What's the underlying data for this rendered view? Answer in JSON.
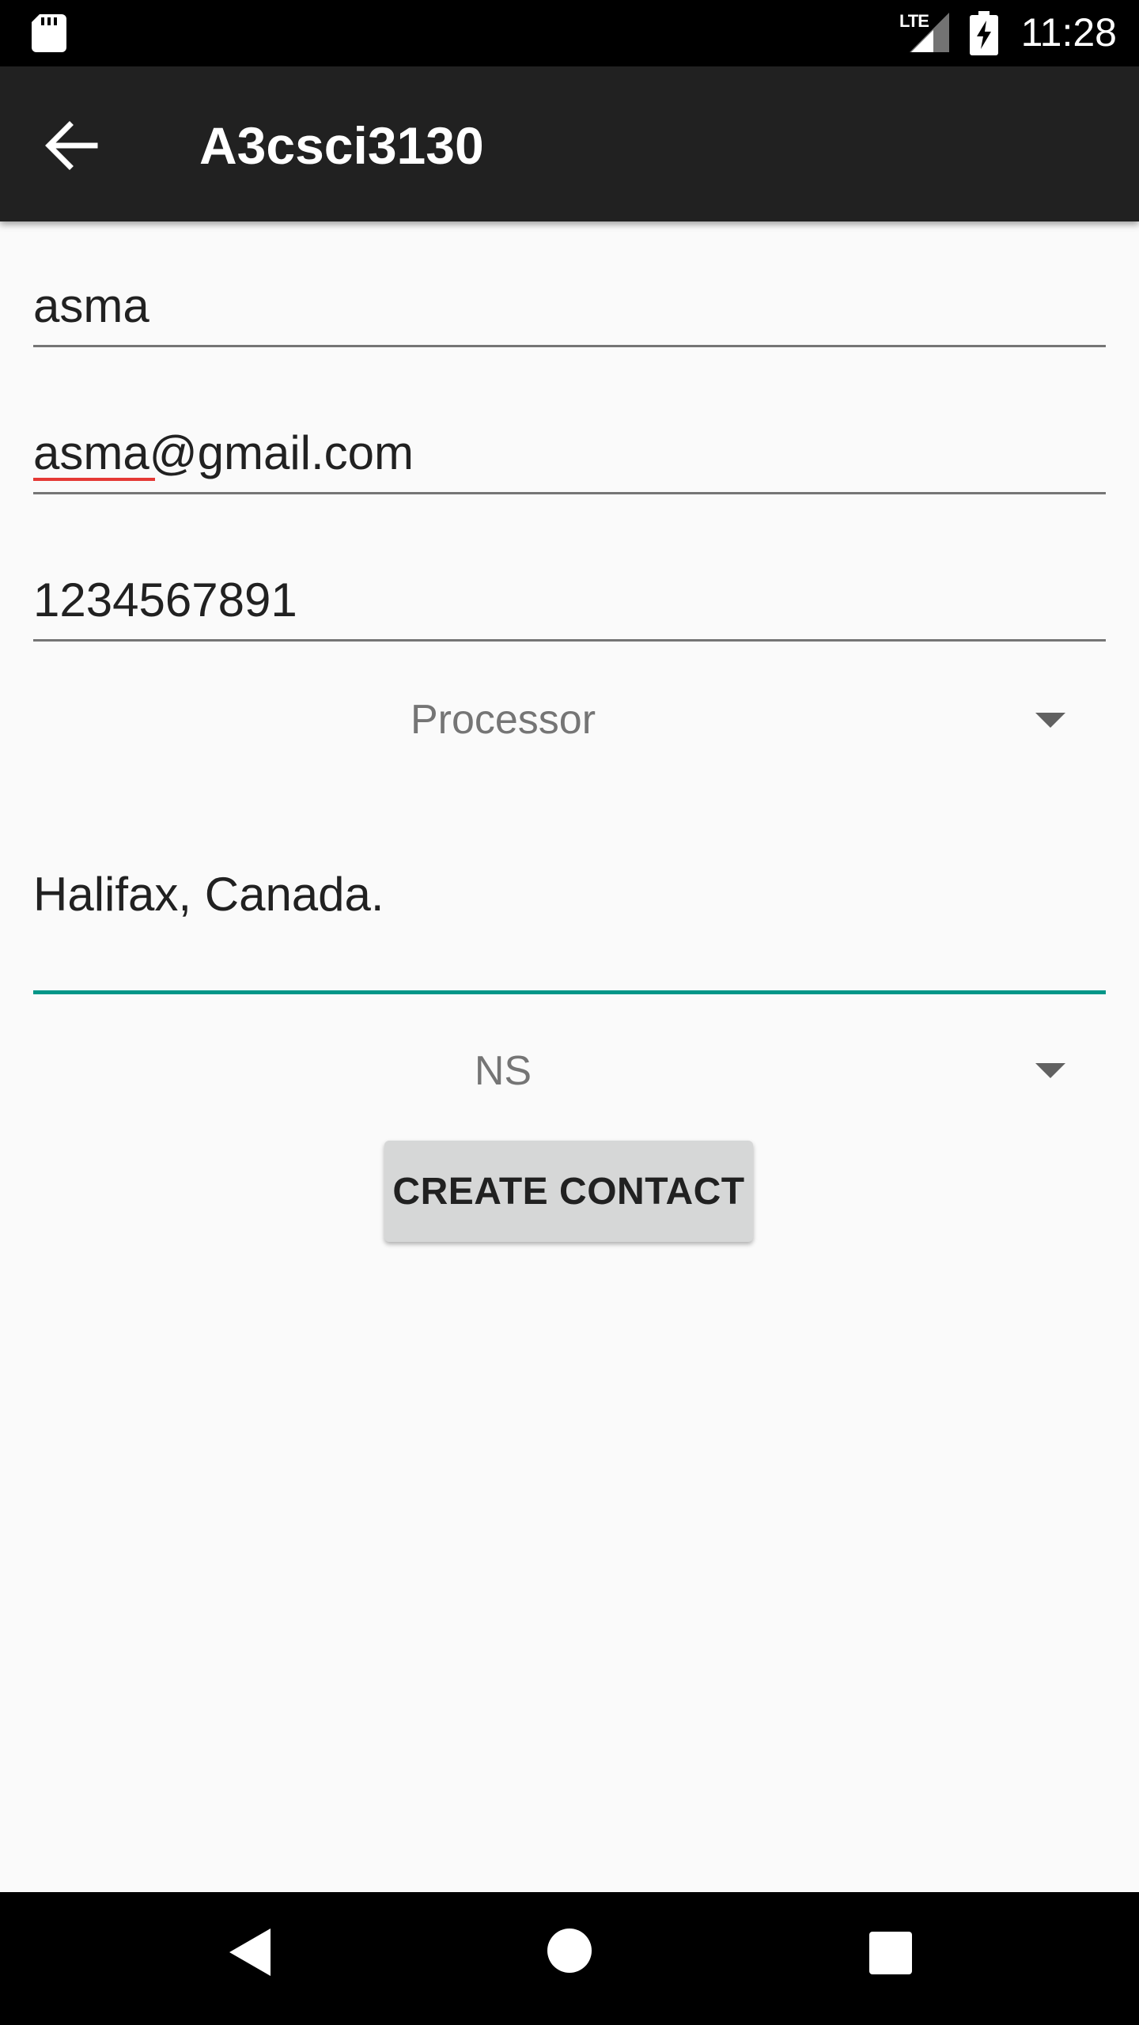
{
  "status_bar": {
    "network_label": "LTE",
    "time": "11:28",
    "icons": [
      "sd-card-icon",
      "signal-icon",
      "battery-charging-icon"
    ]
  },
  "app_bar": {
    "title": "A3csci3130",
    "back_icon": "arrow-left-icon"
  },
  "form": {
    "name_value": "asma",
    "email_value": "asma@gmail.com",
    "phone_value": "1234567891",
    "business_type_selected": "Processor",
    "address_value": "Halifax, Canada.",
    "province_selected": "NS",
    "create_button_label": "CREATE CONTACT"
  },
  "nav_bar": {
    "icons": [
      "nav-back-icon",
      "nav-home-icon",
      "nav-recents-icon"
    ]
  },
  "colors": {
    "focus_accent": "#009688",
    "app_bar_bg": "#212121",
    "spell_error": "#e53935"
  }
}
